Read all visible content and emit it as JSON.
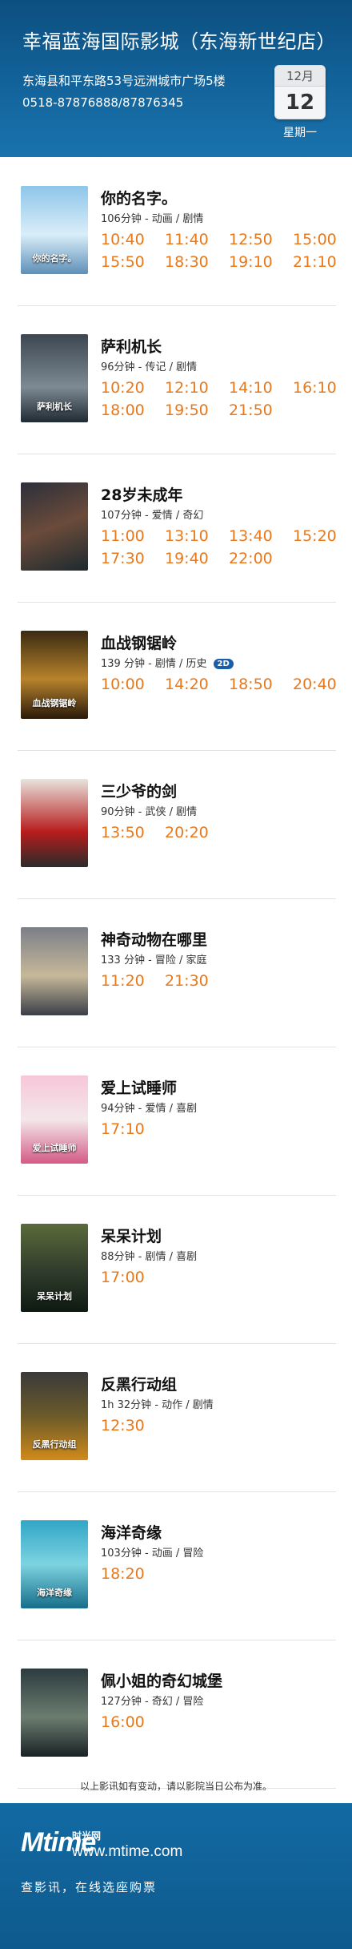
{
  "header": {
    "title": "幸福蓝海国际影城（东海新世纪店）",
    "address": "东海县和平东路53号远洲城市广场5楼",
    "phone": "0518-87876888/87876345",
    "date": {
      "month": "12月",
      "day": "12",
      "weekday": "星期一"
    }
  },
  "movies": [
    {
      "name": "你的名字。",
      "info": "106分钟 - 动画 / 剧情",
      "badge": "",
      "poster_text": "你的名字。",
      "times": [
        "10:40",
        "11:40",
        "12:50",
        "15:00",
        "15:50",
        "18:30",
        "19:10",
        "21:10"
      ]
    },
    {
      "name": "萨利机长",
      "info": "96分钟 - 传记 / 剧情",
      "badge": "",
      "poster_text": "萨利机长",
      "times": [
        "10:20",
        "12:10",
        "14:10",
        "16:10",
        "18:00",
        "19:50",
        "21:50"
      ]
    },
    {
      "name": "28岁未成年",
      "info": "107分钟 - 爱情 / 奇幻",
      "badge": "",
      "poster_text": "",
      "times": [
        "11:00",
        "13:10",
        "13:40",
        "15:20",
        "17:30",
        "19:40",
        "22:00"
      ]
    },
    {
      "name": "血战钢锯岭",
      "info": "139 分钟 - 剧情 / 历史",
      "badge": "2D",
      "poster_text": "血战钢锯岭",
      "times": [
        "10:00",
        "14:20",
        "18:50",
        "20:40"
      ]
    },
    {
      "name": "三少爷的剑",
      "info": "90分钟 - 武侠 / 剧情",
      "badge": "",
      "poster_text": "",
      "times": [
        "13:50",
        "20:20"
      ]
    },
    {
      "name": "神奇动物在哪里",
      "info": "133 分钟 - 冒险 / 家庭",
      "badge": "",
      "poster_text": "",
      "times": [
        "11:20",
        "21:30"
      ]
    },
    {
      "name": "爱上试睡师",
      "info": "94分钟 - 爱情 / 喜剧",
      "badge": "",
      "poster_text": "爱上试睡师",
      "times": [
        "17:10"
      ]
    },
    {
      "name": "呆呆计划",
      "info": "88分钟 - 剧情 / 喜剧",
      "badge": "",
      "poster_text": "呆呆计划",
      "times": [
        "17:00"
      ]
    },
    {
      "name": "反黑行动组",
      "info": "1h 32分钟 - 动作 / 剧情",
      "badge": "",
      "poster_text": "反黑行动组",
      "times": [
        "12:30"
      ]
    },
    {
      "name": "海洋奇缘",
      "info": "103分钟 - 动画 / 冒险",
      "badge": "",
      "poster_text": "海洋奇缘",
      "times": [
        "18:20"
      ]
    },
    {
      "name": "佩小姐的奇幻城堡",
      "info": "127分钟 - 奇幻 / 冒险",
      "badge": "",
      "poster_text": "",
      "times": [
        "16:00"
      ]
    }
  ],
  "notice": "以上影讯如有变动，请以影院当日公布为准。",
  "footer": {
    "logo": "Mtime",
    "logo_cn": "时光网",
    "url": "www.mtime.com",
    "slogan": "查影讯，在线选座购票"
  },
  "colors": {
    "header_blue": "#116097",
    "showtime_orange": "#e9781b",
    "badge_blue": "#1b5ea8"
  }
}
